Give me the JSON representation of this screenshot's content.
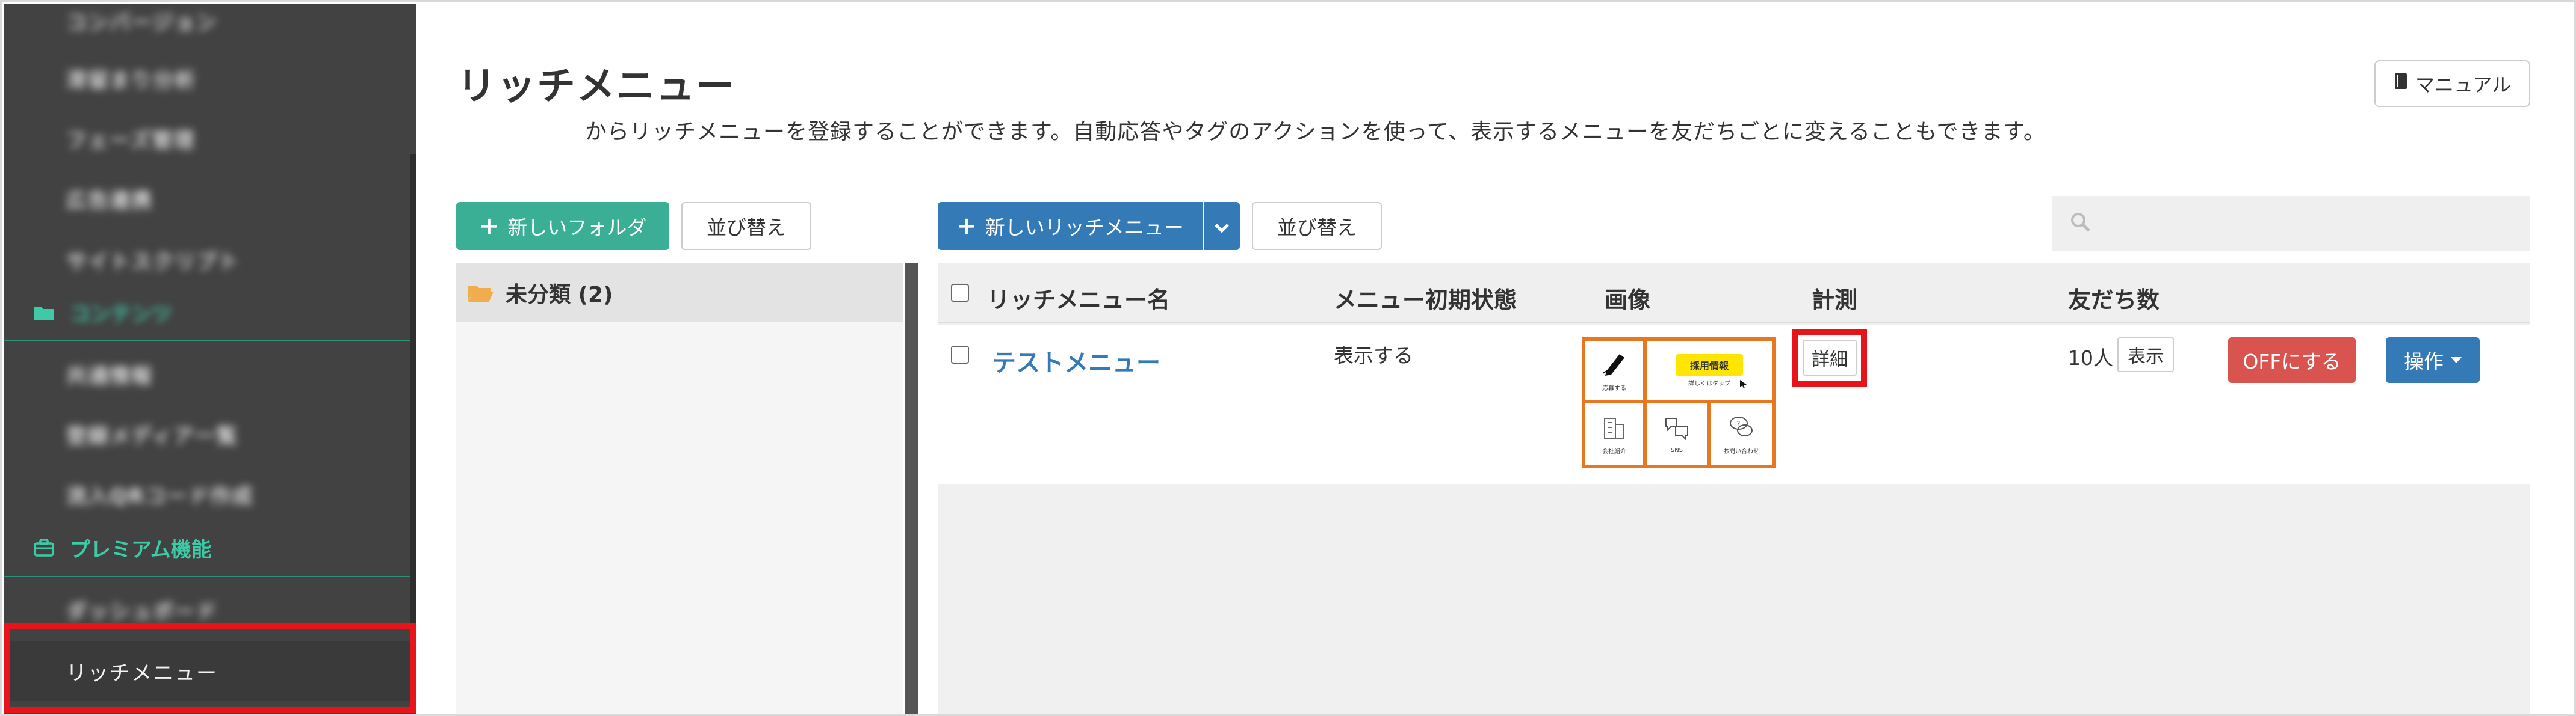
{
  "sidebar": {
    "items": [
      {
        "label": "コンバージョン",
        "blurred": true
      },
      {
        "label": "滞留まり分析",
        "blurred": true
      },
      {
        "label": "フェーズ管理",
        "blurred": true
      },
      {
        "label": "広告連携",
        "blurred": true
      },
      {
        "label": "サイトスクリプト",
        "blurred": true
      }
    ],
    "section_content": {
      "label": "コンテンツ",
      "icon": "folder-icon",
      "blurred": true
    },
    "content_items": [
      {
        "label": "共通情報",
        "blurred": true
      },
      {
        "label": "登録メディア一覧",
        "blurred": true
      },
      {
        "label": "流入QRコード作成",
        "blurred": true
      }
    ],
    "section_premium": {
      "label": "プレミアム機能",
      "icon": "briefcase-icon"
    },
    "premium_items": [
      {
        "label": "ダッシュボード",
        "blurred": true
      },
      {
        "label": "リッチメニュー",
        "selected": true
      }
    ],
    "accent_color": "#3ec9a7",
    "highlight_color": "#e8141a"
  },
  "header": {
    "title": "リッチメニュー",
    "description": "からリッチメニューを登録することができます。自動応答やタグのアクションを使って、表示するメニューを友だちごとに変えることもできます。",
    "manual_label": "マニュアル"
  },
  "folder_toolbar": {
    "new_folder_label": "新しいフォルダ",
    "sort_label": "並び替え"
  },
  "menu_toolbar": {
    "new_menu_label": "新しいリッチメニュー",
    "sort_label": "並び替え",
    "search_placeholder": ""
  },
  "folders": [
    {
      "label": "未分類 (2)"
    }
  ],
  "table": {
    "columns": [
      "リッチメニュー名",
      "メニュー初期状態",
      "画像",
      "計測",
      "友だち数"
    ],
    "rows": [
      {
        "name": "テストメニュー",
        "initial_state": "表示する",
        "image": {
          "tiles": [
            {
              "label": "応募する",
              "icon": "pen-icon"
            },
            {
              "label": "採用情報",
              "sub": "詳しくはタップ",
              "icon": "cursor-icon"
            },
            {
              "label": "会社紹介",
              "icon": "building-icon"
            },
            {
              "label": "SNS",
              "icon": "social-icon"
            },
            {
              "label": "お問い合わせ",
              "icon": "chat-icon"
            }
          ]
        },
        "measure_label": "詳細",
        "friends_count": "10人",
        "show_label": "表示",
        "off_label": "OFFにする",
        "action_label": "操作"
      }
    ]
  },
  "colors": {
    "green": "#3aaf95",
    "blue": "#337ab7",
    "red": "#d9534f",
    "link": "#337ab7",
    "thumbnail_border": "#e87722"
  }
}
